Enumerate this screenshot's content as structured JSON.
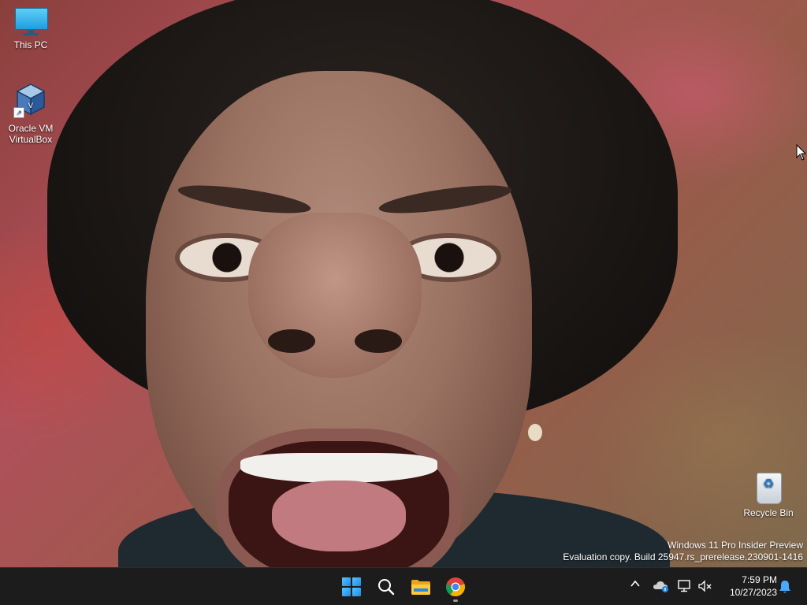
{
  "desktop": {
    "icons": [
      {
        "label": "This PC",
        "icon": "this-pc-icon"
      },
      {
        "label": "Oracle VM\nVirtualBox",
        "icon": "virtualbox-icon"
      },
      {
        "label": "Recycle Bin",
        "icon": "recycle-bin-icon"
      }
    ],
    "watermark": {
      "line1": "Windows 11 Pro Insider Preview",
      "line2": "Evaluation copy. Build 25947.rs_prerelease.230901-1416"
    }
  },
  "taskbar": {
    "apps": [
      {
        "name": "Start",
        "icon": "windows-start-icon"
      },
      {
        "name": "Search",
        "icon": "search-icon"
      },
      {
        "name": "File Explorer",
        "icon": "folder-icon"
      },
      {
        "name": "Google Chrome",
        "icon": "chrome-icon",
        "running": true
      }
    ],
    "tray": {
      "chevron": "^",
      "icons": [
        "onedrive-icon",
        "network-icon",
        "volume-muted-icon"
      ]
    },
    "clock": {
      "time": "7:59 PM",
      "date": "10/27/2023"
    },
    "notification_icon": "bell-icon"
  },
  "colors": {
    "taskbar_bg": "#1c1c1c",
    "accent_blue": "#1e88e5"
  }
}
